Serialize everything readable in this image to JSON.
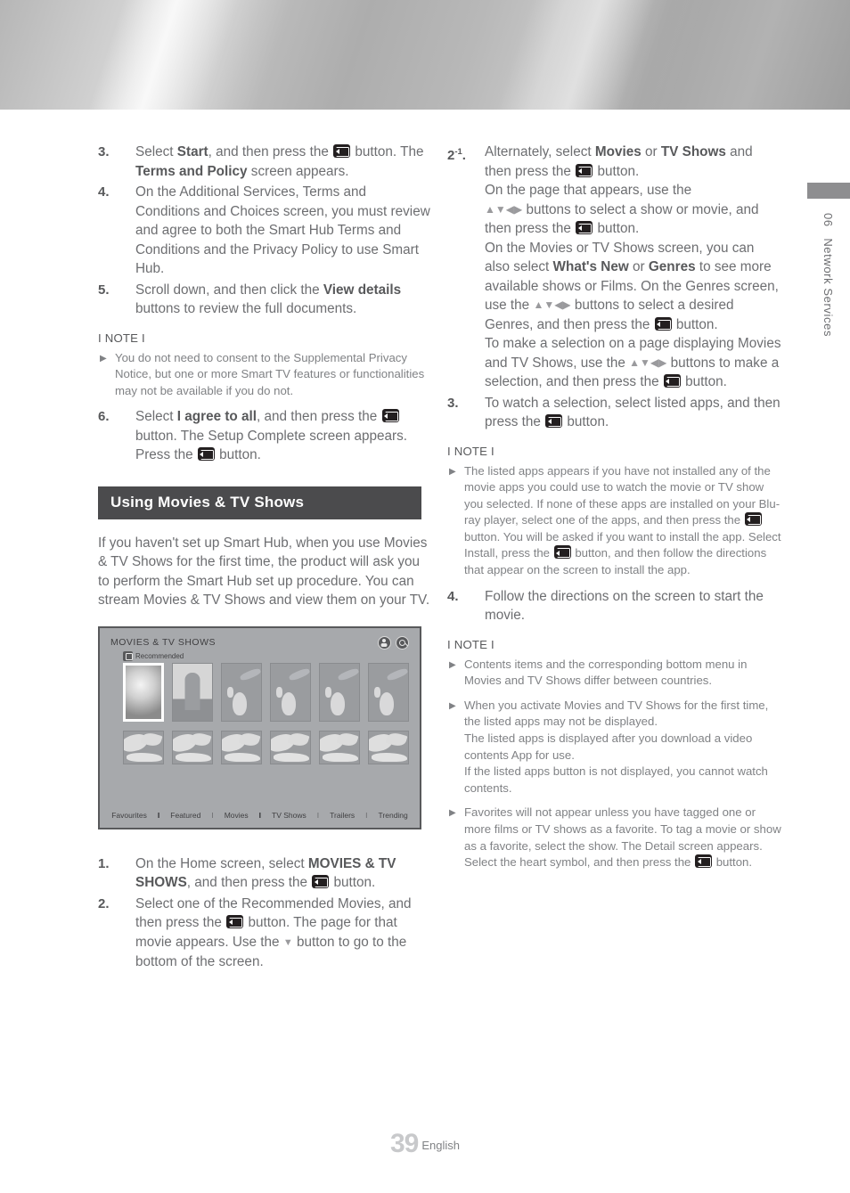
{
  "chapter_tab": {
    "number": "06",
    "label": "Network Services"
  },
  "footer": {
    "page_number": "39",
    "language": "English"
  },
  "left_column": {
    "steps": [
      {
        "num": "3.",
        "parts": [
          {
            "t": "Select ",
            "b": false
          },
          {
            "t": "Start",
            "b": true
          },
          {
            "t": ", and then press the ",
            "b": false
          },
          {
            "t": "[enter]",
            "b": false
          },
          {
            "t": " button. The ",
            "b": false
          },
          {
            "t": "Terms and Policy",
            "b": true
          },
          {
            "t": " screen appears.",
            "b": false
          }
        ]
      },
      {
        "num": "4.",
        "parts": [
          {
            "t": "On the Additional Services, Terms and Conditions and Choices screen, you must review and agree to both the Smart Hub Terms and Conditions and the Privacy Policy to use Smart Hub.",
            "b": false
          }
        ]
      },
      {
        "num": "5.",
        "parts": [
          {
            "t": "Scroll down, and then click the ",
            "b": false
          },
          {
            "t": "View details",
            "b": true
          },
          {
            "t": " buttons to review the full documents.",
            "b": false
          }
        ]
      }
    ],
    "note1": {
      "title": "I NOTE I",
      "items": [
        "You do not need to consent to the Supplemental Privacy Notice, but one or more Smart TV features or functionalities may not be available if you do not."
      ]
    },
    "step6": {
      "num": "6.",
      "parts": [
        {
          "t": "Select ",
          "b": false
        },
        {
          "t": "I agree to all",
          "b": true
        },
        {
          "t": ", and then press the ",
          "b": false
        },
        {
          "t": "[enter]",
          "b": false
        },
        {
          "t": " button. The Setup Complete screen appears. Press the ",
          "b": false
        },
        {
          "t": "[enter]",
          "b": false
        },
        {
          "t": " button.",
          "b": false
        }
      ]
    },
    "section": {
      "heading": "Using Movies & TV Shows",
      "body": "If you haven't set up Smart Hub, when you use Movies & TV Shows for the first time, the product will ask you to perform the Smart Hub set up procedure. You can stream Movies & TV Shows and view them on your TV."
    },
    "figure": {
      "title": "MOVIES & TV SHOWS",
      "recommended_label": "Recommended",
      "icons": [
        "user-icon",
        "search-icon"
      ],
      "nav_items": [
        "Favourites",
        "Featured",
        "Movies",
        "TV Shows",
        "Trailers",
        "Trending"
      ],
      "nav_separators": [
        "bold",
        "light",
        "bold",
        "light",
        "light"
      ]
    },
    "steps_after_figure": [
      {
        "num": "1.",
        "parts": [
          {
            "t": "On the Home screen, select ",
            "b": false
          },
          {
            "t": "MOVIES & TV SHOWS",
            "b": true
          },
          {
            "t": ", and then press the ",
            "b": false
          },
          {
            "t": "[enter]",
            "b": false
          },
          {
            "t": " button.",
            "b": false
          }
        ]
      },
      {
        "num": "2.",
        "parts": [
          {
            "t": "Select one of the Recommended Movies, and then press the ",
            "b": false
          },
          {
            "t": "[enter]",
            "b": false
          },
          {
            "t": " button. The page for that movie appears. Use the ",
            "b": false
          },
          {
            "t": "[down]",
            "b": false
          },
          {
            "t": " button to go to the bottom of the screen.",
            "b": false
          }
        ]
      }
    ]
  },
  "right_column": {
    "step2_1": {
      "num": "2",
      "num_sup": "-1",
      "num_dot": ".",
      "parts": [
        {
          "t": "Alternately, select ",
          "b": false
        },
        {
          "t": "Movies",
          "b": true
        },
        {
          "t": " or ",
          "b": false
        },
        {
          "t": "TV Shows",
          "b": true
        },
        {
          "t": " and then press the ",
          "b": false
        },
        {
          "t": "[enter]",
          "b": false
        },
        {
          "t": " button.",
          "b": false
        },
        {
          "t": "[br]",
          "b": false
        },
        {
          "t": "On the page that appears, use the ",
          "b": false
        },
        {
          "t": "[br]",
          "b": false
        },
        {
          "t": "[arrows]",
          "b": false
        },
        {
          "t": " buttons to select a show or movie, and then press the ",
          "b": false
        },
        {
          "t": "[enter]",
          "b": false
        },
        {
          "t": " button.",
          "b": false
        },
        {
          "t": "[br]",
          "b": false
        },
        {
          "t": "On the Movies or TV Shows screen, you can also select ",
          "b": false
        },
        {
          "t": "What's New",
          "b": true
        },
        {
          "t": " or ",
          "b": false
        },
        {
          "t": "Genres",
          "b": true
        },
        {
          "t": " to see more available shows or Films. On the Genres screen, use the ",
          "b": false
        },
        {
          "t": "[arrows]",
          "b": false
        },
        {
          "t": " buttons to select a desired Genres, and then press the ",
          "b": false
        },
        {
          "t": "[enter]",
          "b": false
        },
        {
          "t": " button.",
          "b": false
        },
        {
          "t": "[br]",
          "b": false
        },
        {
          "t": "To make a selection on a page displaying Movies and TV Shows, use the ",
          "b": false
        },
        {
          "t": "[arrows]",
          "b": false
        },
        {
          "t": " buttons to make a selection, and then press the ",
          "b": false
        },
        {
          "t": "[enter]",
          "b": false
        },
        {
          "t": " button.",
          "b": false
        }
      ]
    },
    "step3": {
      "num": "3.",
      "parts": [
        {
          "t": "To watch a selection, select listed apps, and then press the ",
          "b": false
        },
        {
          "t": "[enter]",
          "b": false
        },
        {
          "t": " button.",
          "b": false
        }
      ]
    },
    "note1": {
      "title": "I NOTE I",
      "items": [
        [
          {
            "t": "The listed apps appears if you have not installed any of the movie apps you could use to watch the movie or TV show you selected. If none of these apps are installed on your Blu-ray player, select one of the apps, and then press the ",
            "b": false
          },
          {
            "t": "[enter]",
            "b": false
          },
          {
            "t": " button. You will be asked if you want to install the app. Select Install, press the ",
            "b": false
          },
          {
            "t": "[enter]",
            "b": false
          },
          {
            "t": " button, and then follow the directions that appear on the screen to install the app.",
            "b": false
          }
        ]
      ]
    },
    "step4": {
      "num": "4.",
      "parts": [
        {
          "t": "Follow the directions on the screen to start the movie.",
          "b": false
        }
      ]
    },
    "note2": {
      "title": "I NOTE I",
      "items": [
        [
          {
            "t": "Contents items and the corresponding bottom menu in Movies and TV Shows differ between countries.",
            "b": false
          }
        ],
        [
          {
            "t": "When you activate Movies and TV Shows for the first time, the listed apps may not be displayed.",
            "b": false
          },
          {
            "t": "[br]",
            "b": false
          },
          {
            "t": "The listed apps is displayed after you download a video contents App for use.",
            "b": false
          },
          {
            "t": "[br]",
            "b": false
          },
          {
            "t": "If the listed apps button is not displayed, you cannot watch contents.",
            "b": false
          }
        ],
        [
          {
            "t": "Favorites will not appear unless you have tagged one or more  films or TV shows as a favorite. To tag a movie or show as a favorite, select the show. The Detail screen appears. Select the heart symbol, and then press the ",
            "b": false
          },
          {
            "t": "[enter]",
            "b": false
          },
          {
            "t": " button.",
            "b": false
          }
        ]
      ]
    }
  }
}
